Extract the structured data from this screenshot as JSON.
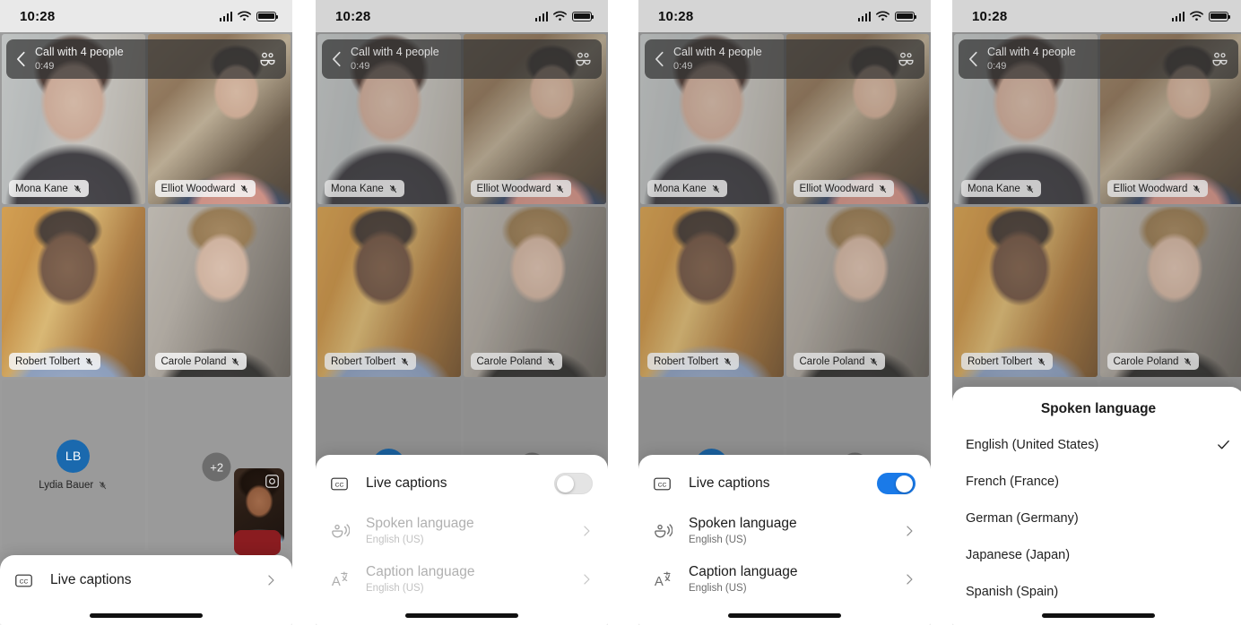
{
  "status_bar": {
    "time": "10:28",
    "signal_icon": "cellular-bars-icon",
    "wifi_icon": "wifi-icon",
    "battery_icon": "battery-full-icon"
  },
  "call_header": {
    "title": "Call with 4 people",
    "duration": "0:49",
    "back_icon": "back-chevron-icon",
    "people_icon": "people-icon"
  },
  "participants": [
    {
      "name": "Mona Kane",
      "muted": true
    },
    {
      "name": "Elliot Woodward",
      "muted": true
    },
    {
      "name": "Robert Tolbert",
      "muted": true
    },
    {
      "name": "Carole Poland",
      "muted": true
    }
  ],
  "avatar_tile": {
    "initials": "LB",
    "name": "Lydia Bauer",
    "muted": true
  },
  "overflow_tile": {
    "more_count": "+2",
    "flip_camera_icon": "flip-camera-icon"
  },
  "collapsed_sheet": {
    "icon": "closed-caption-icon",
    "label": "Live captions",
    "chevron": "chevron-right-icon"
  },
  "captions_sheet": {
    "live_captions": {
      "icon": "closed-caption-icon",
      "label": "Live captions",
      "toggle_off_state": "off",
      "toggle_on_state": "on"
    },
    "spoken_language": {
      "icon": "speaking-mouth-icon",
      "label": "Spoken language",
      "value": "English (US)",
      "chevron": "chevron-right-icon"
    },
    "caption_language": {
      "icon": "translate-icon",
      "label": "Caption language",
      "value": "English (US)",
      "chevron": "chevron-right-icon"
    }
  },
  "language_picker": {
    "title": "Spoken language",
    "options": [
      {
        "label": "English (United States)",
        "selected": true
      },
      {
        "label": "French (France)",
        "selected": false
      },
      {
        "label": "German (Germany)",
        "selected": false
      },
      {
        "label": "Japanese (Japan)",
        "selected": false
      },
      {
        "label": "Spanish (Spain)",
        "selected": false
      }
    ],
    "check_icon": "checkmark-icon"
  },
  "colors": {
    "accent_blue": "#1a7ae8",
    "avatar_blue": "#1a69ae",
    "hangup_red": "#8a1c20",
    "sheet_white": "#ffffff",
    "grid_gray": "#9a9a9a"
  }
}
